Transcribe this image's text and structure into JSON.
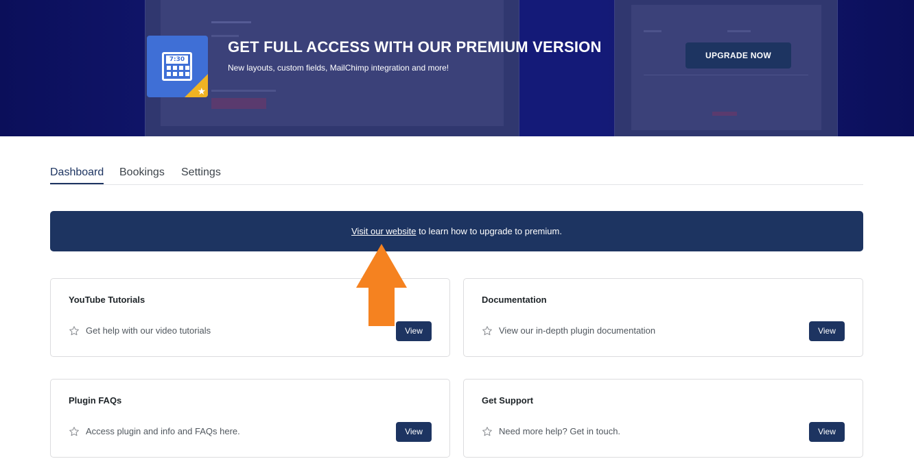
{
  "hero": {
    "logo_time": "7:30",
    "title": "GET FULL ACCESS WITH OUR PREMIUM VERSION",
    "subtitle": "New layouts, custom fields, MailChimp integration and more!",
    "upgrade_label": "UPGRADE NOW",
    "logo_icon": "calculator-icon",
    "badge_icon": "star-icon"
  },
  "tabs": [
    {
      "label": "Dashboard",
      "active": true
    },
    {
      "label": "Bookings",
      "active": false
    },
    {
      "label": "Settings",
      "active": false
    }
  ],
  "notice": {
    "link_text": "Visit our website",
    "text": " to learn how to upgrade to premium."
  },
  "cards": [
    {
      "title": "YouTube Tutorials",
      "description": "Get help with our video tutorials",
      "button": "View",
      "icon": "star-outline-icon"
    },
    {
      "title": "Documentation",
      "description": "View our in-depth plugin documentation",
      "button": "View",
      "icon": "star-outline-icon"
    },
    {
      "title": "Plugin FAQs",
      "description": "Access plugin and info and FAQs here.",
      "button": "View",
      "icon": "star-outline-icon"
    },
    {
      "title": "Get Support",
      "description": "Need more help? Get in touch.",
      "button": "View",
      "icon": "star-outline-icon"
    }
  ],
  "colors": {
    "hero_bg": "#141a78",
    "primary": "#1d3461",
    "accent_arrow": "#f58220",
    "badge": "#f0b323"
  }
}
